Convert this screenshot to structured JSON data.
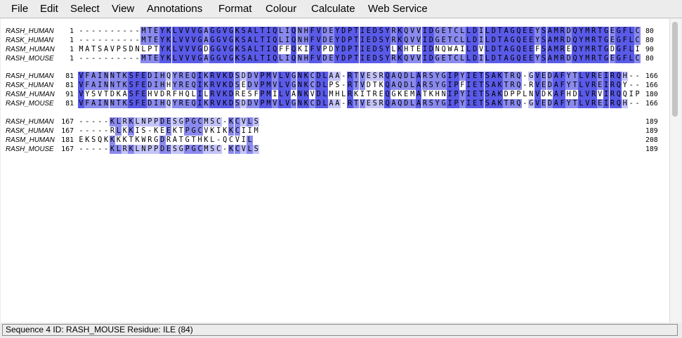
{
  "menu": [
    "File",
    "Edit",
    "Select",
    "View",
    "Annotations",
    "Format",
    "Colour",
    "Calculate",
    "Web Service"
  ],
  "status": "Sequence 4 ID: RASH_MOUSE Residue: ILE (84)",
  "colors": {
    "high": "#5a5ae8",
    "mid": "#8a8aee",
    "low": "#c4c4f8"
  },
  "blocks": [
    {
      "rows": [
        {
          "name": "RASH_HUMAN",
          "start": "1",
          "end": "80",
          "seq": "----------MTEYKLVVVGAGGVGKSALTIQLIQNHFVDEYDPTIEDSYRKQVVIDGETCLLDILDTAGQEEYSAMRDQYMRTGEGFLC"
        },
        {
          "name": "RASK_HUMAN",
          "start": "1",
          "end": "80",
          "seq": "----------MTEYKLVVVGAGGVGKSALTIQLIQNHFVDEYDPTIEDSYRKQVVIDGETCLLDILDTAGQEEYSAMRDQYMRTGEGFLC"
        },
        {
          "name": "RASM_HUMAN",
          "start": "1",
          "end": "90",
          "seq": "MATSAVPSDNLPTYKLVVVGDGGVGKSALTIQFFQKIFVPDYDPTIEDSYLKHTEIDNQWAILDVLDTAGQEEFSAMREQYMRTGDGFLI"
        },
        {
          "name": "RASH_MOUSE",
          "start": "1",
          "end": "80",
          "seq": "----------MTEYKLVVVGAGGVGKSALTIQLIQNHFVDEYDPTIEDSYRKQVVIDGETCLLDILDTAGQEEYSAMRDQYMRTGEGFLC"
        }
      ]
    },
    {
      "rows": [
        {
          "name": "RASH_HUMAN",
          "start": "81",
          "end": "166",
          "seq": "VFAINNTKSFEDIHQYREQIKRVKDSDDVPMVLVGNKCDLAA-RTVESRQAQDLARSYGIPYIETSAKTRQ-GVEDAFYTLVREIRQH--"
        },
        {
          "name": "RASK_HUMAN",
          "start": "81",
          "end": "166",
          "seq": "VFAINNTKSFEDIHHYREQIKRVKDSEDVPMVLVGNKCDLPS-RTVDTKQAQDLARSYGIPFIETSAKTRQ-RVEDAFYTLVREIRQY--"
        },
        {
          "name": "RASM_HUMAN",
          "start": "91",
          "end": "180",
          "seq": "VYSVTDKASFEHVDRFHQLILRVKDRESFPMILVANKVDLMHLRKITREQGKEMATKHNIPYIETSAKDPPLNVDKAFHDLVRVIRQQIP"
        },
        {
          "name": "RASH_MOUSE",
          "start": "81",
          "end": "166",
          "seq": "VFAINNTKSFEDIHQYREQIKRVKDSDDVPMVLVGNKCDLAA-RTVESRQAQDLARSYGIPYIETSAKTRQ-GVEDAFYTLVREIRQH--"
        }
      ]
    },
    {
      "rows": [
        {
          "name": "RASH_HUMAN",
          "start": "167",
          "end": "189",
          "seq": "-----KLRKLNPPDESGPGCMSC-KCVLS"
        },
        {
          "name": "RASK_HUMAN",
          "start": "167",
          "end": "189",
          "seq": "-----RLKKIS-KEEKTPGCVKIKKCIIM"
        },
        {
          "name": "RASM_HUMAN",
          "start": "181",
          "end": "208",
          "seq": "EKSQKKKKTKWRGDRATGTHKL-QCVIL"
        },
        {
          "name": "RASH_MOUSE",
          "start": "167",
          "end": "189",
          "seq": "-----KLRKLNPPDESGPGCMSC-KCVLS"
        }
      ]
    }
  ]
}
